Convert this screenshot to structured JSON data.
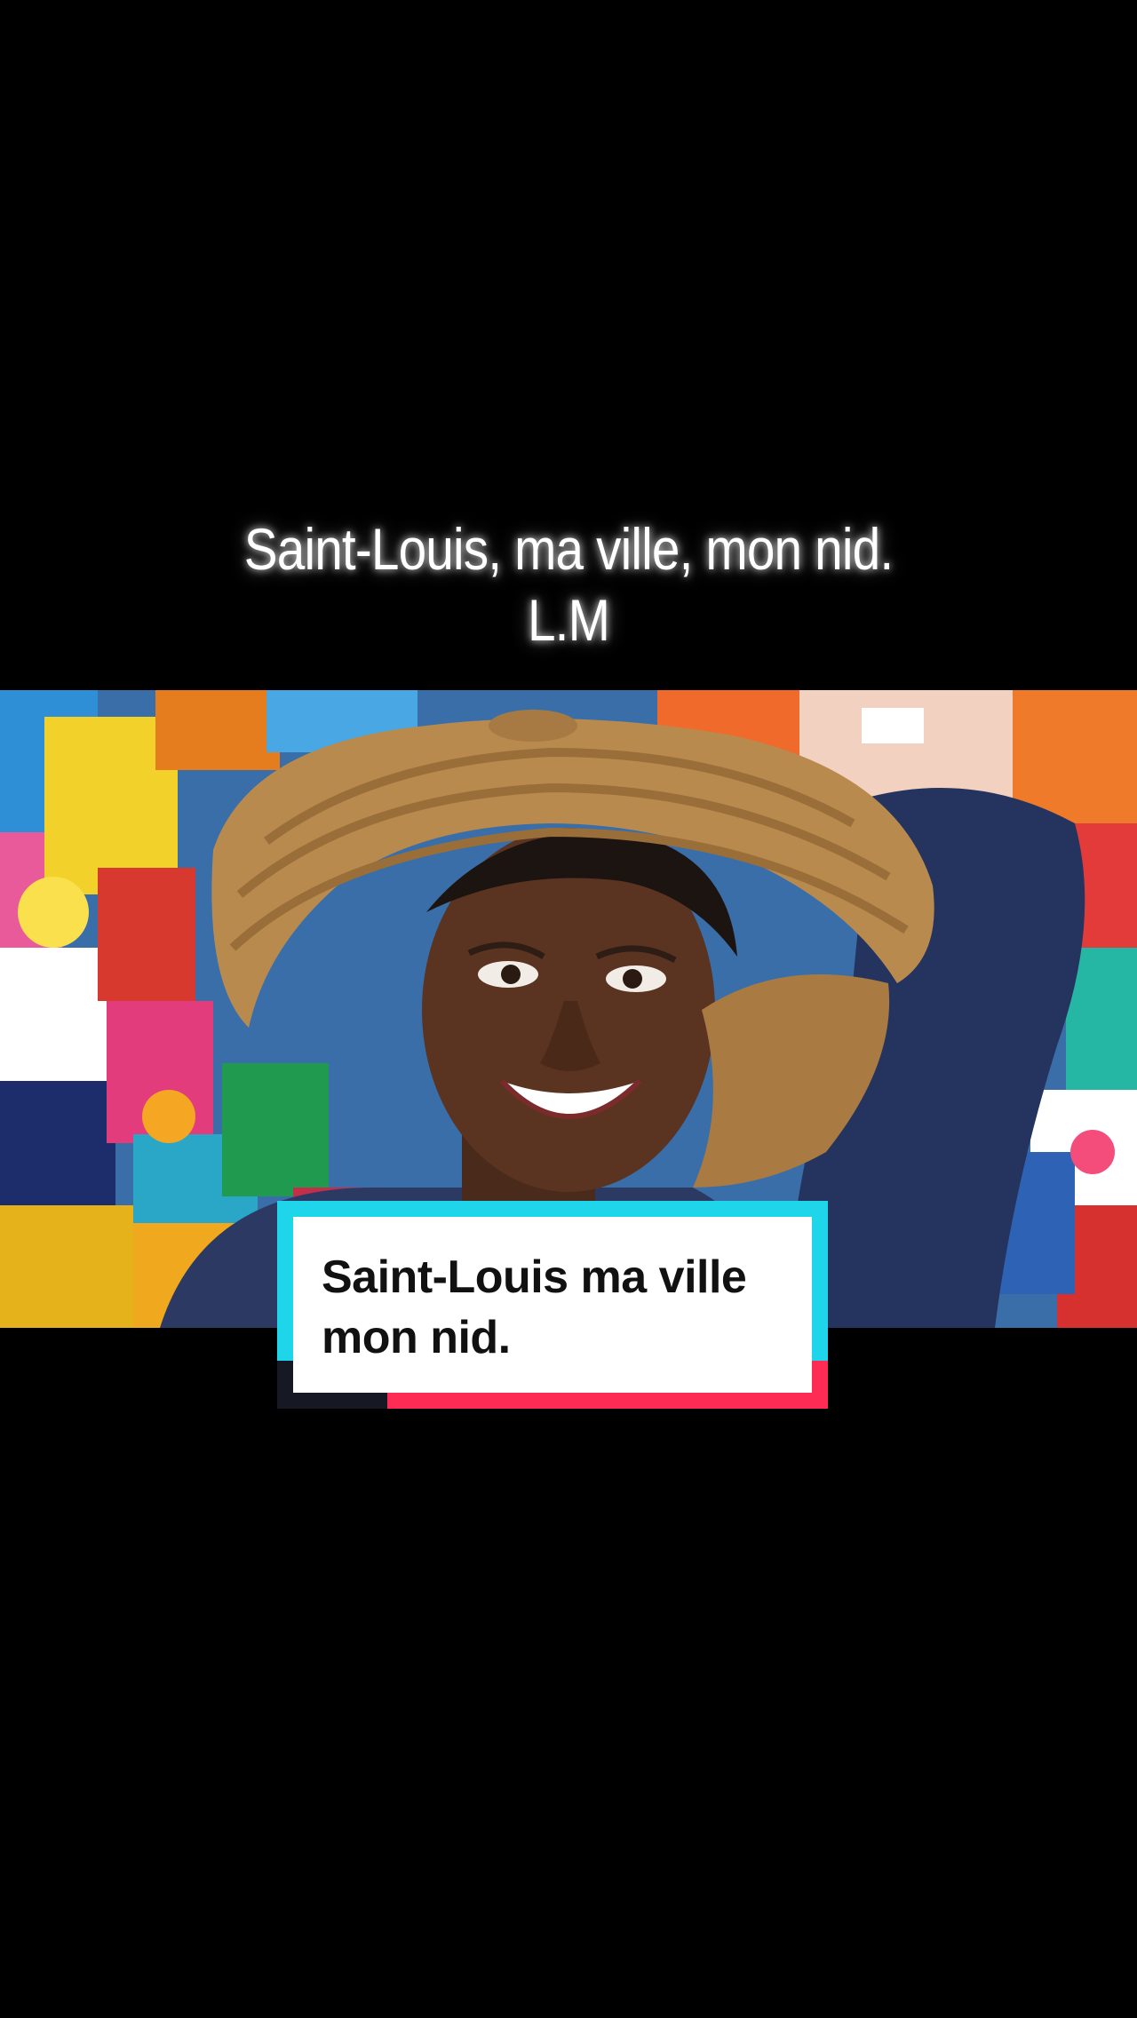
{
  "overlay_caption": {
    "line1": "Saint-Louis, ma ville, mon nid.",
    "line2": "L.M"
  },
  "video": {
    "scene": "smiling-woman-straw-hat-patchwork-background"
  },
  "text_sticker": {
    "line1": "Saint-Louis ma ville",
    "line2": "mon nid.",
    "colors": {
      "cyan": "#1fd5ea",
      "red": "#fe2c55",
      "dark": "#161823",
      "card": "#ffffff"
    }
  }
}
